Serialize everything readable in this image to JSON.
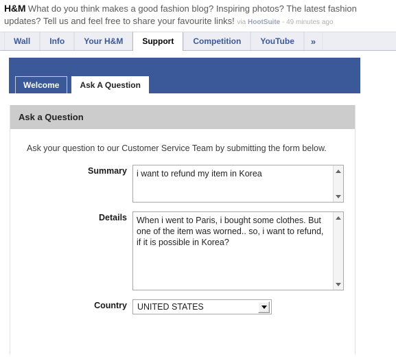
{
  "post": {
    "author": "H&M",
    "text": "What do you think makes a good fashion blog? Inspiring photos? The latest fashion updates? Tell us and feel free to share your favourite links!",
    "via_prefix": "via",
    "source": "HootSuite",
    "separator": "-",
    "timestamp": "49 minutes ago"
  },
  "tabs": [
    {
      "label": "Wall",
      "active": false
    },
    {
      "label": "Info",
      "active": false
    },
    {
      "label": "Your H&M",
      "active": false
    },
    {
      "label": "Support",
      "active": true
    },
    {
      "label": "Competition",
      "active": false
    },
    {
      "label": "YouTube",
      "active": false
    }
  ],
  "more_tabs_icon": "»",
  "inner_tabs": [
    {
      "label": "Welcome",
      "active": false
    },
    {
      "label": "Ask A Question",
      "active": true
    }
  ],
  "panel": {
    "title": "Ask a Question",
    "intro": "Ask your question to our Customer Service Team by submitting the form below."
  },
  "form": {
    "summary": {
      "label": "Summary",
      "value": "i want to refund my item in Korea",
      "placeholder": ""
    },
    "details": {
      "label": "Details",
      "value": "When i went to Paris, i bought some clothes. But one of the item was worned.. so, i want to refund, if it is possible in Korea?",
      "placeholder": ""
    },
    "country": {
      "label": "Country",
      "value": "UNITED STATES"
    }
  },
  "colors": {
    "brand_blue": "#3b5998",
    "panel_header_gray": "#cccccc",
    "tabstrip_bg": "#eceef4"
  }
}
